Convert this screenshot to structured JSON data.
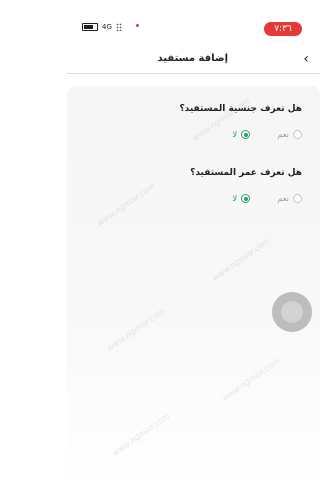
{
  "status_bar": {
    "time": "٧:٣٦",
    "network": "4G"
  },
  "header": {
    "title": "إضافة مستفيد",
    "back_icon": "chevron-right-icon"
  },
  "questions": [
    {
      "label": "هل تعرف جنسية المستفيد؟",
      "options": [
        {
          "label": "نعم",
          "selected": false
        },
        {
          "label": "لا",
          "selected": true
        }
      ]
    },
    {
      "label": "هل تعرف عمر المستفيد؟",
      "options": [
        {
          "label": "نعم",
          "selected": false
        },
        {
          "label": "لا",
          "selected": true
        }
      ]
    }
  ],
  "watermark": "www.ngmisr.com",
  "colors": {
    "accent": "#22a66a",
    "time_pill": "#e53935"
  }
}
